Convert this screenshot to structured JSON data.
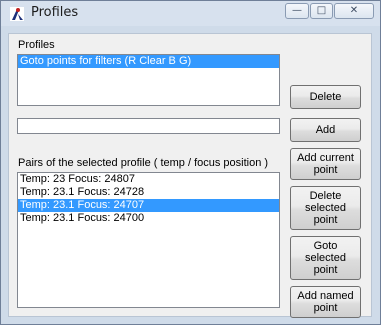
{
  "window": {
    "title": "Profiles",
    "icon": "telescope-app-icon",
    "controls": {
      "minimize": "—",
      "maximize": "□",
      "close": "✕"
    }
  },
  "profiles": {
    "label": "Profiles",
    "items": [
      {
        "text": "Goto points for filters (R Clear B G)",
        "selected": true
      }
    ]
  },
  "name_input": {
    "value": ""
  },
  "pairs": {
    "label": "Pairs of the selected profile ( temp / focus position )",
    "items": [
      {
        "text": "Temp: 23 Focus: 24807",
        "selected": false
      },
      {
        "text": "Temp: 23.1 Focus: 24728",
        "selected": false
      },
      {
        "text": "Temp: 23.1 Focus: 24707",
        "selected": true
      },
      {
        "text": "Temp: 23.1 Focus: 24700",
        "selected": false
      }
    ]
  },
  "buttons": {
    "delete": "Delete",
    "add": "Add",
    "add_current_point": "Add current\npoint",
    "delete_selected_point": "Delete\nselected\npoint",
    "goto_selected_point": "Goto\nselected\npoint",
    "add_named_point": "Add named\npoint"
  },
  "colors": {
    "selection": "#3399ff",
    "frame": "#cfdbe9"
  }
}
